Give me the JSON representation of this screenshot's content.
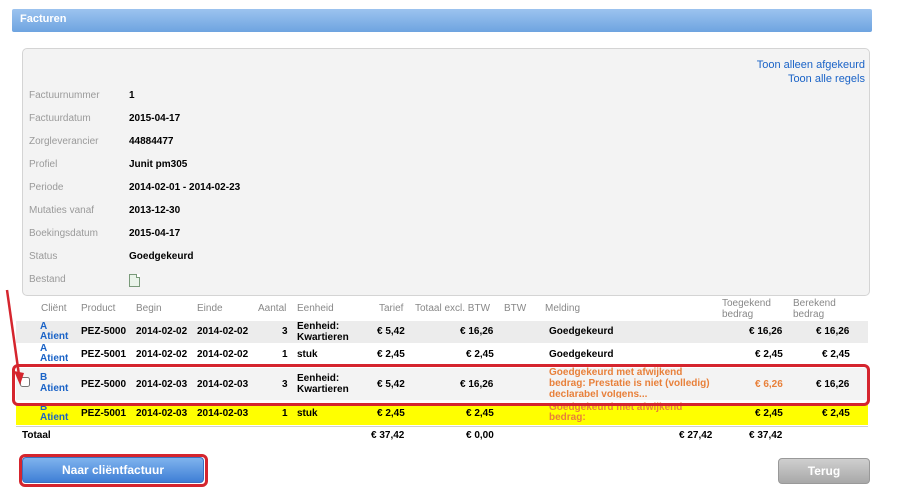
{
  "window": {
    "title": "Facturen"
  },
  "links": {
    "approved_only": "Toon alleen afgekeurd",
    "all_lines": "Toon alle regels"
  },
  "details": [
    {
      "label": "Factuurnummer",
      "value": "1"
    },
    {
      "label": "Factuurdatum",
      "value": "2015-04-17"
    },
    {
      "label": "Zorgleverancier",
      "value": "44884477"
    },
    {
      "label": "Profiel",
      "value": "Junit pm305"
    },
    {
      "label": "Periode",
      "value": "2014-02-01 - 2014-02-23"
    },
    {
      "label": "Mutaties vanaf",
      "value": "2013-12-30"
    },
    {
      "label": "Boekingsdatum",
      "value": "2015-04-17"
    },
    {
      "label": "Status",
      "value": "Goedgekeurd"
    },
    {
      "label": "Bestand",
      "value": ""
    }
  ],
  "table": {
    "headers": {
      "client": "Cliënt",
      "product": "Product",
      "begin": "Begin",
      "end": "Einde",
      "count": "Aantal",
      "unit": "Eenheid",
      "rate": "Tarief",
      "total_ex": "Totaal excl. BTW",
      "vat": "BTW",
      "message": "Melding",
      "granted_1": "Toegekend",
      "granted_2": "bedrag",
      "calc_1": "Berekend",
      "calc_2": "bedrag"
    },
    "rows": [
      {
        "client_1": "A",
        "client_2": "Atient",
        "product": "PEZ-5000",
        "begin": "2014-02-02",
        "end": "2014-02-02",
        "count": "3",
        "unit_1": "Eenheid:",
        "unit_2": "Kwartieren",
        "rate": "€ 5,42",
        "total_ex": "€ 16,26",
        "message_1": "Goedgekeurd",
        "message_2": "",
        "message_3": "",
        "granted": "€ 16,26",
        "calc": "€ 16,26"
      },
      {
        "client_1": "A",
        "client_2": "Atient",
        "product": "PEZ-5001",
        "begin": "2014-02-02",
        "end": "2014-02-02",
        "count": "1",
        "unit_1": "stuk",
        "unit_2": "",
        "rate": "€ 2,45",
        "total_ex": "€ 2,45",
        "message_1": "Goedgekeurd",
        "message_2": "",
        "message_3": "",
        "granted": "€ 2,45",
        "calc": "€ 2,45"
      },
      {
        "client_1": "B",
        "client_2": "Atient",
        "product": "PEZ-5000",
        "begin": "2014-02-03",
        "end": "2014-02-03",
        "count": "3",
        "unit_1": "Eenheid:",
        "unit_2": "Kwartieren",
        "rate": "€ 5,42",
        "total_ex": "€ 16,26",
        "message_1": "Goedgekeurd met afwijkend",
        "message_2": "bedrag: Prestatie is niet (volledig)",
        "message_3": "declarabel volgens...",
        "granted": "€ 6,26",
        "calc": "€ 16,26"
      },
      {
        "client_1": "B",
        "client_2": "Atient",
        "product": "PEZ-5001",
        "begin": "2014-02-03",
        "end": "2014-02-03",
        "count": "1",
        "unit_1": "stuk",
        "unit_2": "",
        "rate": "€ 2,45",
        "total_ex": "€ 2,45",
        "message_1": "Goedgekeurd met afwijkend",
        "message_2": "bedrag:",
        "message_3": "",
        "granted": "€ 2,45",
        "calc": "€ 2,45"
      }
    ],
    "totals": {
      "label": "Totaal",
      "rate": "€ 37,42",
      "total_ex": "€ 0,00",
      "vat": "€ 27,42",
      "granted": "€ 37,42"
    }
  },
  "buttons": {
    "client_invoice": "Naar cliëntfactuur",
    "back": "Terug"
  },
  "colors": {
    "highlight_row": "#ffff00",
    "annotation_red": "#d5252e",
    "link_blue": "#1a63c7",
    "warning_orange": "#e8803a"
  }
}
